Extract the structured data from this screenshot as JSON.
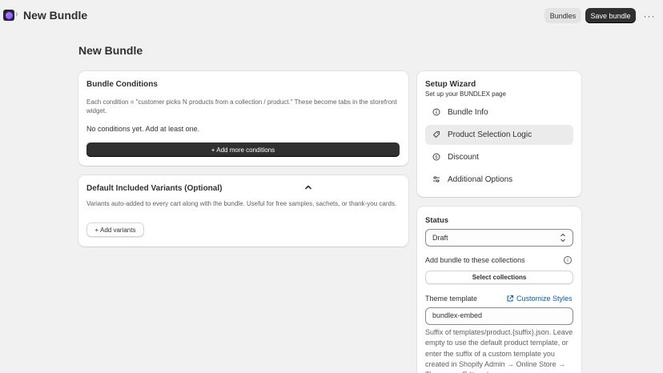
{
  "topbar": {
    "crumb_chevron": "›",
    "title": "New Bundle",
    "bundles_label": "Bundles",
    "save_label": "Save bundle",
    "more_label": "···"
  },
  "page": {
    "title": "New Bundle"
  },
  "conditions": {
    "title": "Bundle Conditions",
    "description": "Each condition = \"customer picks N products from a collection / product.\" These become tabs in the storefront widget.",
    "empty_text": "No conditions yet. Add at least one.",
    "add_button": "+ Add more conditions"
  },
  "variants": {
    "title": "Default Included Variants (Optional)",
    "description": "Variants auto-added to every cart along with the bundle. Useful for free samples, sachets, or thank-you cards.",
    "add_button": "+ Add variants"
  },
  "wizard": {
    "title": "Setup Wizard",
    "subtitle": "Set up your BUNDLEX page",
    "items": [
      {
        "label": "Bundle Info",
        "icon": "info-icon",
        "glyph": "ⓘ",
        "active": false
      },
      {
        "label": "Product Selection Logic",
        "icon": "tag-icon",
        "glyph": "⌂",
        "active": true
      },
      {
        "label": "Discount",
        "icon": "discount-icon",
        "glyph": "$",
        "active": false
      },
      {
        "label": "Additional Options",
        "icon": "sliders-icon",
        "glyph": "≡",
        "active": false
      }
    ]
  },
  "status_card": {
    "status_label": "Status",
    "status_value": "Draft",
    "collections_label": "Add bundle to these collections",
    "select_collections": "Select collections",
    "theme_label": "Theme template",
    "customize_link": "Customize Styles",
    "theme_value": "bundlex-embed",
    "help_text": "Suffix of templates/product.{suffix}.json. Leave empty to use the default product template, or enter the suffix of a custom template you created in Shopify Admin → Online Store → Themes → Edit code."
  },
  "colors": {
    "page_bg": "#f1f1f1",
    "primary_button": "#303030",
    "link": "#005bd3"
  }
}
